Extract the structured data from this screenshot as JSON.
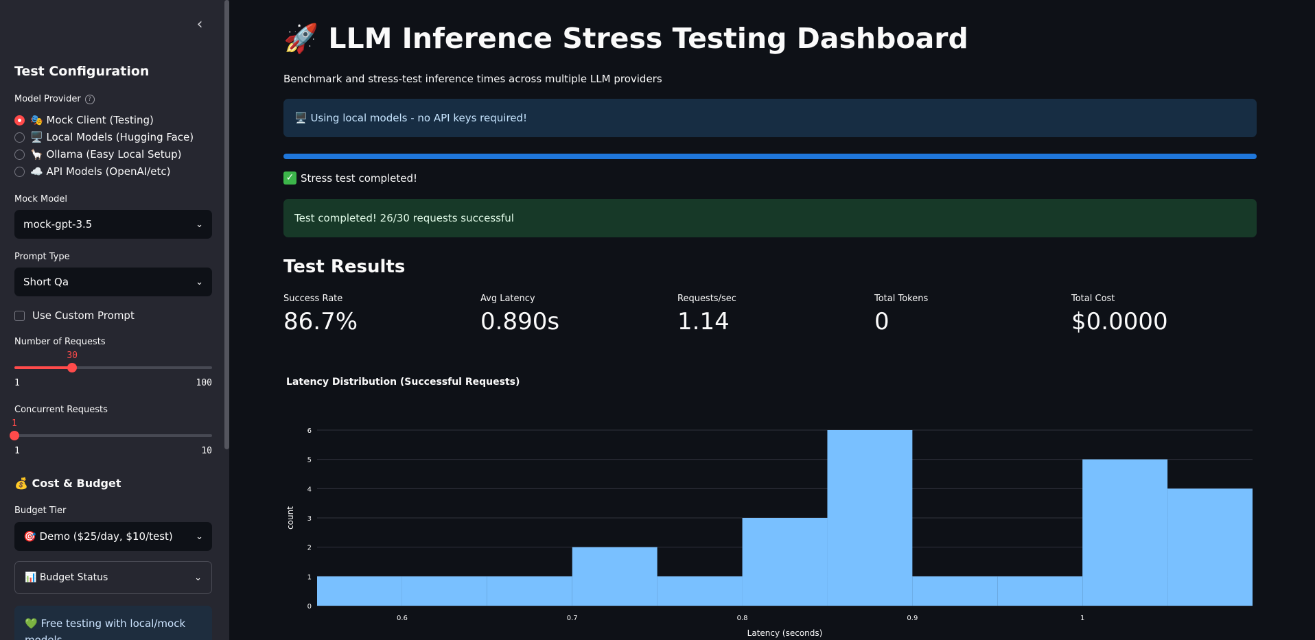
{
  "sidebar": {
    "collapse_icon": "chevron-left-icon",
    "heading": "Test Configuration",
    "provider_label": "Model Provider",
    "provider_help": "?",
    "providers": [
      {
        "label": "🎭 Mock Client (Testing)",
        "selected": true
      },
      {
        "label": "🖥️ Local Models (Hugging Face)",
        "selected": false
      },
      {
        "label": "🦙 Ollama (Easy Local Setup)",
        "selected": false
      },
      {
        "label": "☁️ API Models (OpenAI/etc)",
        "selected": false
      }
    ],
    "mock_model_label": "Mock Model",
    "mock_model_value": "mock-gpt-3.5",
    "prompt_type_label": "Prompt Type",
    "prompt_type_value": "Short Qa",
    "custom_prompt_label": "Use Custom Prompt",
    "requests_label": "Number of Requests",
    "requests": {
      "value": 30,
      "min": 1,
      "max": 100,
      "value_text": "30",
      "min_text": "1",
      "max_text": "100"
    },
    "concurrent_label": "Concurrent Requests",
    "concurrent": {
      "value": 1,
      "min": 1,
      "max": 10,
      "value_text": "1",
      "min_text": "1",
      "max_text": "10"
    },
    "cost_heading": "💰 Cost & Budget",
    "budget_tier_label": "Budget Tier",
    "budget_tier_value": "🎯 Demo ($25/day, $10/test)",
    "budget_status_label": "📊 Budget Status",
    "free_info": "💚 Free testing with local/mock models"
  },
  "main": {
    "title": "🚀 LLM Inference Stress Testing Dashboard",
    "subtitle": "Benchmark and stress-test inference times across multiple LLM providers",
    "info_alert": "🖥️ Using local models - no API keys required!",
    "progress": 1.0,
    "status_text": "Stress test completed!",
    "success_alert": "Test completed! 26/30 requests successful",
    "results_heading": "Test Results",
    "metrics": [
      {
        "label": "Success Rate",
        "value": "86.7%"
      },
      {
        "label": "Avg Latency",
        "value": "0.890s"
      },
      {
        "label": "Requests/sec",
        "value": "1.14"
      },
      {
        "label": "Total Tokens",
        "value": "0"
      },
      {
        "label": "Total Cost",
        "value": "$0.0000"
      }
    ]
  },
  "colors": {
    "accent": "#ff4b4b",
    "bar": "#79c0ff",
    "progress": "#1f77db"
  },
  "chart_data": {
    "type": "bar",
    "title": "Latency Distribution (Successful Requests)",
    "xlabel": "Latency (seconds)",
    "ylabel": "count",
    "bin_width": 0.05,
    "bins": [
      {
        "start": 0.55,
        "end": 0.6,
        "count": 1
      },
      {
        "start": 0.6,
        "end": 0.65,
        "count": 1
      },
      {
        "start": 0.65,
        "end": 0.7,
        "count": 1
      },
      {
        "start": 0.7,
        "end": 0.75,
        "count": 2
      },
      {
        "start": 0.75,
        "end": 0.8,
        "count": 1
      },
      {
        "start": 0.8,
        "end": 0.85,
        "count": 3
      },
      {
        "start": 0.85,
        "end": 0.9,
        "count": 6
      },
      {
        "start": 0.9,
        "end": 0.95,
        "count": 1
      },
      {
        "start": 0.95,
        "end": 1.0,
        "count": 1
      },
      {
        "start": 1.0,
        "end": 1.05,
        "count": 5
      },
      {
        "start": 1.05,
        "end": 1.1,
        "count": 4
      }
    ],
    "xlim": [
      0.55,
      1.1
    ],
    "ylim": [
      0,
      6
    ],
    "x_ticks": [
      0.6,
      0.7,
      0.8,
      0.9,
      1
    ],
    "x_tick_labels": [
      "0.6",
      "0.7",
      "0.8",
      "0.9",
      "1"
    ],
    "y_ticks": [
      0,
      1,
      2,
      3,
      4,
      5,
      6
    ],
    "y_tick_labels": [
      "0",
      "1",
      "2",
      "3",
      "4",
      "5",
      "6"
    ],
    "grid": true
  }
}
